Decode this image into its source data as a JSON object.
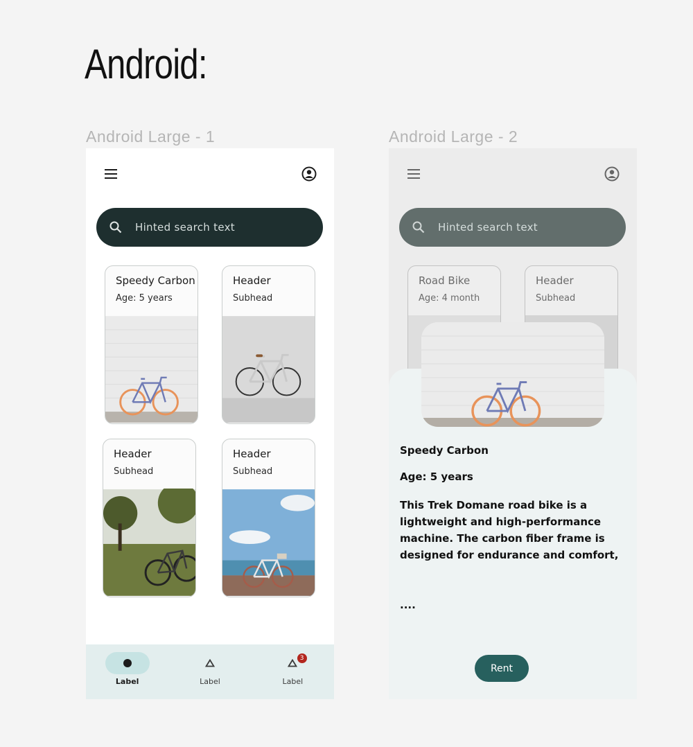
{
  "page_title": "Android:",
  "frames": [
    {
      "label": "Android Large - 1",
      "search_placeholder": "Hinted search text",
      "cards": [
        {
          "title": "Speedy Carbon",
          "subtitle": "Age: 5 years",
          "image": "bike-against-white-brick-wall"
        },
        {
          "title": "Header",
          "subtitle": "Subhead",
          "image": "silver-bike-against-white-wall"
        },
        {
          "title": "Header",
          "subtitle": "Subhead",
          "image": "bike-under-tree-on-grass"
        },
        {
          "title": "Header",
          "subtitle": "Subhead",
          "image": "bike-on-boardwalk-by-sea"
        }
      ],
      "nav": [
        {
          "label": "Label",
          "icon": "dot-icon",
          "active": true
        },
        {
          "label": "Label",
          "icon": "triangle-icon"
        },
        {
          "label": "Label",
          "icon": "triangle-icon",
          "badge": "3"
        }
      ]
    },
    {
      "label": "Android Large - 2",
      "search_placeholder": "Hinted search text",
      "cards": [
        {
          "title": "Road Bike",
          "subtitle": "Age: 4 month"
        },
        {
          "title": "Header",
          "subtitle": "Subhead"
        }
      ],
      "detail": {
        "title": "Speedy Carbon",
        "age": "Age: 5 years",
        "description": "This Trek Domane road bike is a lightweight and high-performance machine. The carbon fiber frame is designed for endurance and comfort,",
        "more": "....",
        "rent_button": "Rent"
      }
    }
  ],
  "colors": {
    "search_dark": "#1e2f2f",
    "nav_bg": "#e3eeee",
    "rent_button": "#27605e",
    "badge": "#b3261e"
  }
}
